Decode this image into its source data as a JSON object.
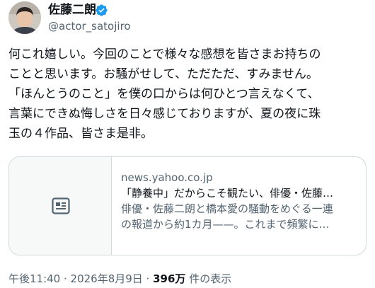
{
  "user": {
    "display_name": "佐藤二朗",
    "handle": "@actor_satojiro",
    "verified_icon": "verified-badge-icon",
    "badge_color": "#1d9bf0"
  },
  "tweet": {
    "lines": [
      "何これ嬉しい。今回のことで様々な感想を皆さまお持ちの",
      "ことと思います。お騒がせして、ただただ、すみません。",
      "「ほんとうのこと」を僕の口からは何ひとつ言えなくて、",
      "言葉にできぬ悔しさを日々感じておりますが、夏の夜に珠",
      "玉の４作品、皆さま是非。"
    ]
  },
  "card": {
    "icon": "article-icon",
    "domain": "news.yahoo.co.jp",
    "title": "「静養中」だからこそ観たい、俳優・佐藤…",
    "description_lines": [
      "俳優・佐藤二朗と橋本愛の騒動をめぐる一連",
      "の報道から約1カ月——。これまで頻繁に…"
    ]
  },
  "meta": {
    "timestamp": "午後11:40 · 2026年8月9日 · ",
    "views_count": "396万",
    "views_label": " 件の表示"
  }
}
